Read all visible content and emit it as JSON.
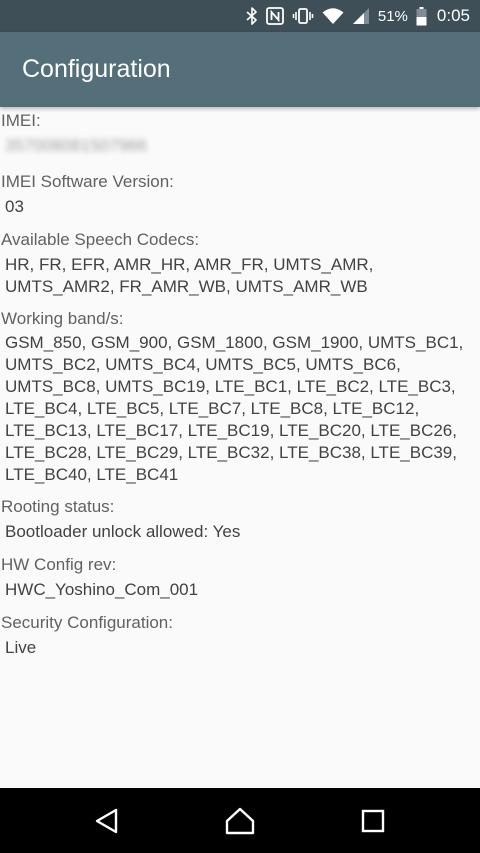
{
  "status_bar": {
    "battery_percent": "51%",
    "time": "0:05",
    "icons": [
      "bluetooth-icon",
      "nfc-icon",
      "vibrate-icon",
      "wifi-icon",
      "signal-icon",
      "battery-icon"
    ]
  },
  "app_bar": {
    "title": "Configuration"
  },
  "sections": [
    {
      "label": "IMEI:",
      "value": "357008081507966"
    },
    {
      "label": "IMEI Software Version:",
      "value": "03"
    },
    {
      "label": "Available Speech Codecs:",
      "value": [
        "HR, FR, EFR, AMR_HR, AMR_FR, UMTS_AMR,",
        "UMTS_AMR2, FR_AMR_WB, UMTS_AMR_WB"
      ]
    },
    {
      "label": "Working band/s:",
      "value": [
        "GSM_850, GSM_900, GSM_1800, GSM_1900, UMTS_BC1,",
        "UMTS_BC2, UMTS_BC4, UMTS_BC5, UMTS_BC6,",
        "UMTS_BC8, UMTS_BC19, LTE_BC1, LTE_BC2, LTE_BC3,",
        "LTE_BC4, LTE_BC5, LTE_BC7, LTE_BC8, LTE_BC12,",
        "LTE_BC13, LTE_BC17, LTE_BC19, LTE_BC20, LTE_BC26,",
        "LTE_BC28, LTE_BC29, LTE_BC32, LTE_BC38, LTE_BC39,",
        "LTE_BC40, LTE_BC41"
      ]
    },
    {
      "label": "Rooting status:",
      "value": "Bootloader unlock allowed: Yes"
    },
    {
      "label": "HW Config rev:",
      "value": "HWC_Yoshino_Com_001"
    },
    {
      "label": "Security Configuration:",
      "value": "Live"
    }
  ],
  "nav_bar": {
    "buttons": [
      "back-icon",
      "home-icon",
      "recents-icon"
    ]
  },
  "colors": {
    "status_bar": "#3e4f58",
    "app_bar": "#546e7a",
    "background": "#fafafa",
    "label_text": "#616161",
    "value_text": "#424242",
    "nav_bar": "#000000"
  }
}
